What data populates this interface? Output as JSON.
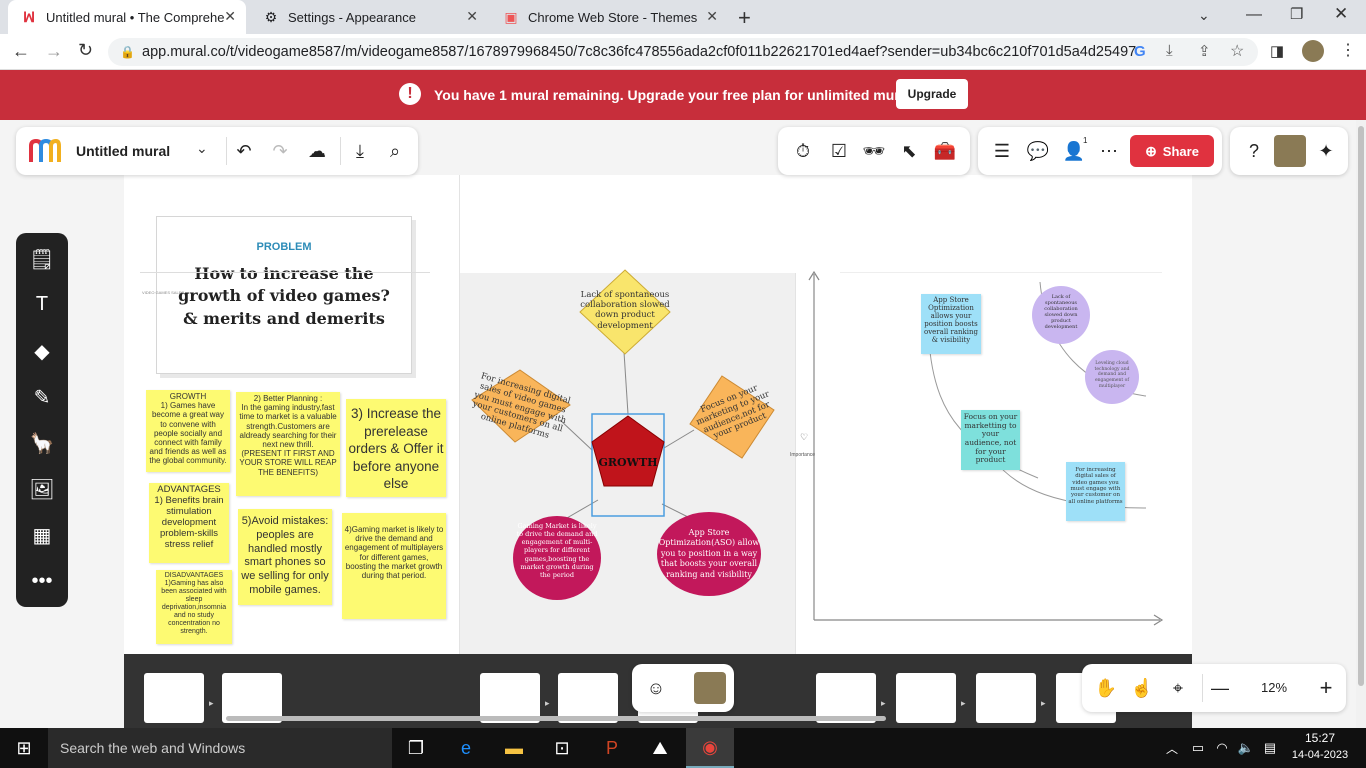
{
  "browser": {
    "tabs": [
      {
        "title": "Untitled mural • The Comprehen",
        "icon": "mural-logo-icon"
      },
      {
        "title": "Settings - Appearance",
        "icon": "gear-icon"
      },
      {
        "title": "Chrome Web Store - Themes",
        "icon": "webstore-icon"
      }
    ],
    "url": "app.mural.co/t/videogame8587/m/videogame8587/1678979968450/7c8c36fc478556ada2cf0f011b22621701ed4aef?sender=ub34bc6c210f701d5a4d25497"
  },
  "banner": {
    "message_prefix": "You have ",
    "count": "1",
    "message_suffix": " mural remaining. Upgrade your free plan for unlimited murals.",
    "button": "Upgrade"
  },
  "mural": {
    "title": "Untitled mural",
    "share_label": "Share",
    "collaborator_count": "1",
    "zoom": "12%"
  },
  "board": {
    "problem_label": "PROBLEM",
    "problem_title": "How to increase the growth of video games? & merits and demerits",
    "tiny_label": "VIDEO GAMES SALES",
    "notes": {
      "growth": "GROWTH\n1) Games have become a great way to convene with people socially and connect with family and friends as well as the global community.",
      "planning": "2) Better Planning :\nIn the gaming industry,fast time to market is a valuable strength.Customers are aldready searching for their next new thrill.\n(PRESENT IT FIRST AND YOUR STORE WILL REAP THE BENEFITS)",
      "prerelease": "3) Increase the prerelease orders & Offer it before anyone else",
      "advantages": "ADVANTAGES\n1) Benefits brain stimulation development problem-skills stress relief",
      "mistakes": "5)Avoid mistakes: peoples are handled mostly smart phones so we selling for only mobile games.",
      "market": "4)Gaming market is likely to drive the demand and engagement of multiplayers for different games, boosting the market growth during that period.",
      "disadvantages": "DISADVANTAGES\n1)Gaming has also been associated with sleep deprivation,insomnia and no study concentration no strength."
    },
    "mindmap": {
      "center": "GROWTH",
      "top": "Lack of spontaneous collaboration slowed down product development",
      "left": "For increasing digital sales of video games you must engage with your customers on all online platforms",
      "right": "Focus on your marketing to your audience,not for your product",
      "bottom_left": "Gaming Market is likely to drive the demand and engagement of multi-players for different games,boosting the market growth during the period",
      "bottom_right": "App Store Optimization(ASO) allow you to position in a way that boosts your overall ranking and visibility"
    },
    "matrix": {
      "importance_label": "Importance",
      "aso": "App Store Optimization allows your position boosts overall ranking & visibility",
      "lack": "Lack of spontaneous collaboration slowed down product development",
      "cloud": "Leveling cloud technology and demand and engagement of multiplayer",
      "focus": "Focus on your marketting to your audience, not for your product",
      "digital": "For increasing digital sales of video games you must engage with your customer on all online platforms"
    }
  },
  "taskbar": {
    "search_placeholder": "Search the web and Windows",
    "time": "15:27",
    "date": "14-04-2023"
  },
  "colors": {
    "banner": "#c72e3b",
    "sticky_yellow": "#fdfa72",
    "diamond": "#f9e56c",
    "orange_diamond": "#f9b55a",
    "pentagon": "#c0141b",
    "magenta": "#c2185b",
    "light_blue": "#9ee0f8",
    "teal": "#7ee0dc",
    "lavender": "#c9b6f0",
    "share_red": "#e0323f"
  }
}
